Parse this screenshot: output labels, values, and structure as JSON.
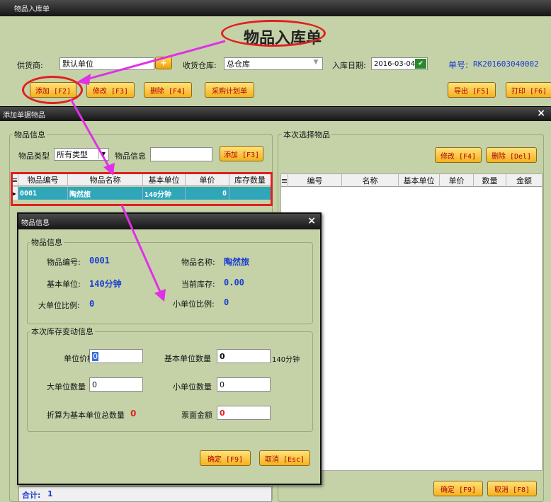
{
  "main": {
    "window_title": "物品入库单",
    "form_title": "物品入库单",
    "supplier_label": "供货商:",
    "supplier_value": "默认单位",
    "add_supplier_label": "+",
    "warehouse_label": "收货仓库:",
    "warehouse_value": "总仓库",
    "date_label": "入库日期:",
    "date_value": "2016-03-04",
    "doc_no_label": "单号:",
    "doc_no_value": "RK201603040002",
    "toolbar": {
      "add": "添加 [F2]",
      "edit": "修改 [F3]",
      "delete": "删除 [F4]",
      "purchase_plan": "采购计划单",
      "export": "导出 [F5]",
      "print": "打印 [F6]"
    },
    "total_label": "合计:",
    "total_value": "1"
  },
  "dialog": {
    "title": "添加单据物品",
    "close": "×",
    "goods_info_group": "物品信息",
    "type_label": "物品类型",
    "type_value": "所有类型",
    "info_label": "物品信息",
    "info_value": "",
    "add_btn": "添加 [F3]",
    "table": {
      "headers": [
        "物品编号",
        "物品名称",
        "基本单位",
        "单价",
        "库存数量"
      ],
      "rows": [
        [
          "0001",
          "陶然旅",
          "140分钟",
          "0",
          ""
        ]
      ]
    },
    "selected_group": "本次选择物品",
    "edit_btn": "修改 [F4]",
    "delete_btn": "删除 [Del]",
    "sel_table": {
      "headers": [
        "编号",
        "名称",
        "基本单位",
        "单价",
        "数量",
        "金额"
      ]
    },
    "ok_btn": "确定 [F9]",
    "cancel_btn": "取消 [F8]"
  },
  "popup": {
    "title": "物品信息",
    "close": "×",
    "info_group": "物品信息",
    "code_label": "物品编号:",
    "code_value": "0001",
    "name_label": "物品名称:",
    "name_value": "陶然旅",
    "unit_label": "基本单位:",
    "unit_value": "140分钟",
    "stock_label": "当前库存:",
    "stock_value": "0.00",
    "big_ratio_label": "大单位比例:",
    "big_ratio_value": "0",
    "small_ratio_label": "小单位比例:",
    "small_ratio_value": "0",
    "change_group": "本次库存变动信息",
    "price_label": "单位价格",
    "price_value": "0",
    "base_qty_label": "基本单位数量",
    "base_qty_value": "0",
    "base_unit_suffix": "140分钟",
    "big_qty_label": "大单位数量",
    "big_qty_value": "0",
    "small_qty_label": "小单位数量",
    "small_qty_value": "0",
    "total_base_label": "折算为基本单位总数量",
    "total_base_value": "0",
    "amount_label": "票面金额",
    "amount_value": "0",
    "ok_btn": "确定 [F9]",
    "cancel_btn": "取消 [Esc]"
  },
  "colors": {
    "accent_blue": "#1a3ecf",
    "annotation": "#e030e8",
    "highlight": "#e02020",
    "selected_row": "#2fa7b8"
  }
}
